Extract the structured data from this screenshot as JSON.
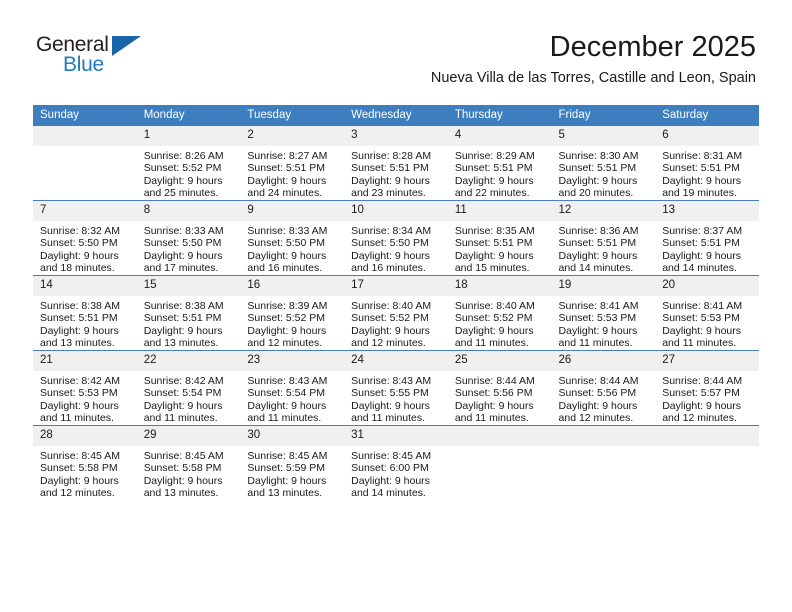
{
  "brand": {
    "name_top": "General",
    "name_bottom": "Blue",
    "triangle_color": "#1764a8",
    "blue_color": "#1d7cc4"
  },
  "header": {
    "title": "December 2025",
    "location": "Nueva Villa de las Torres, Castille and Leon, Spain",
    "header_bg": "#3d7ebf"
  },
  "calendar": {
    "weekday_headers": [
      "Sunday",
      "Monday",
      "Tuesday",
      "Wednesday",
      "Thursday",
      "Friday",
      "Saturday"
    ],
    "weeks": [
      [
        {
          "day": "",
          "sunrise": "",
          "sunset": "",
          "daylight_line1": "",
          "daylight_line2": ""
        },
        {
          "day": "1",
          "sunrise": "Sunrise: 8:26 AM",
          "sunset": "Sunset: 5:52 PM",
          "daylight_line1": "Daylight: 9 hours",
          "daylight_line2": "and 25 minutes."
        },
        {
          "day": "2",
          "sunrise": "Sunrise: 8:27 AM",
          "sunset": "Sunset: 5:51 PM",
          "daylight_line1": "Daylight: 9 hours",
          "daylight_line2": "and 24 minutes."
        },
        {
          "day": "3",
          "sunrise": "Sunrise: 8:28 AM",
          "sunset": "Sunset: 5:51 PM",
          "daylight_line1": "Daylight: 9 hours",
          "daylight_line2": "and 23 minutes."
        },
        {
          "day": "4",
          "sunrise": "Sunrise: 8:29 AM",
          "sunset": "Sunset: 5:51 PM",
          "daylight_line1": "Daylight: 9 hours",
          "daylight_line2": "and 22 minutes."
        },
        {
          "day": "5",
          "sunrise": "Sunrise: 8:30 AM",
          "sunset": "Sunset: 5:51 PM",
          "daylight_line1": "Daylight: 9 hours",
          "daylight_line2": "and 20 minutes."
        },
        {
          "day": "6",
          "sunrise": "Sunrise: 8:31 AM",
          "sunset": "Sunset: 5:51 PM",
          "daylight_line1": "Daylight: 9 hours",
          "daylight_line2": "and 19 minutes."
        }
      ],
      [
        {
          "day": "7",
          "sunrise": "Sunrise: 8:32 AM",
          "sunset": "Sunset: 5:50 PM",
          "daylight_line1": "Daylight: 9 hours",
          "daylight_line2": "and 18 minutes."
        },
        {
          "day": "8",
          "sunrise": "Sunrise: 8:33 AM",
          "sunset": "Sunset: 5:50 PM",
          "daylight_line1": "Daylight: 9 hours",
          "daylight_line2": "and 17 minutes."
        },
        {
          "day": "9",
          "sunrise": "Sunrise: 8:33 AM",
          "sunset": "Sunset: 5:50 PM",
          "daylight_line1": "Daylight: 9 hours",
          "daylight_line2": "and 16 minutes."
        },
        {
          "day": "10",
          "sunrise": "Sunrise: 8:34 AM",
          "sunset": "Sunset: 5:50 PM",
          "daylight_line1": "Daylight: 9 hours",
          "daylight_line2": "and 16 minutes."
        },
        {
          "day": "11",
          "sunrise": "Sunrise: 8:35 AM",
          "sunset": "Sunset: 5:51 PM",
          "daylight_line1": "Daylight: 9 hours",
          "daylight_line2": "and 15 minutes."
        },
        {
          "day": "12",
          "sunrise": "Sunrise: 8:36 AM",
          "sunset": "Sunset: 5:51 PM",
          "daylight_line1": "Daylight: 9 hours",
          "daylight_line2": "and 14 minutes."
        },
        {
          "day": "13",
          "sunrise": "Sunrise: 8:37 AM",
          "sunset": "Sunset: 5:51 PM",
          "daylight_line1": "Daylight: 9 hours",
          "daylight_line2": "and 14 minutes."
        }
      ],
      [
        {
          "day": "14",
          "sunrise": "Sunrise: 8:38 AM",
          "sunset": "Sunset: 5:51 PM",
          "daylight_line1": "Daylight: 9 hours",
          "daylight_line2": "and 13 minutes."
        },
        {
          "day": "15",
          "sunrise": "Sunrise: 8:38 AM",
          "sunset": "Sunset: 5:51 PM",
          "daylight_line1": "Daylight: 9 hours",
          "daylight_line2": "and 13 minutes."
        },
        {
          "day": "16",
          "sunrise": "Sunrise: 8:39 AM",
          "sunset": "Sunset: 5:52 PM",
          "daylight_line1": "Daylight: 9 hours",
          "daylight_line2": "and 12 minutes."
        },
        {
          "day": "17",
          "sunrise": "Sunrise: 8:40 AM",
          "sunset": "Sunset: 5:52 PM",
          "daylight_line1": "Daylight: 9 hours",
          "daylight_line2": "and 12 minutes."
        },
        {
          "day": "18",
          "sunrise": "Sunrise: 8:40 AM",
          "sunset": "Sunset: 5:52 PM",
          "daylight_line1": "Daylight: 9 hours",
          "daylight_line2": "and 11 minutes."
        },
        {
          "day": "19",
          "sunrise": "Sunrise: 8:41 AM",
          "sunset": "Sunset: 5:53 PM",
          "daylight_line1": "Daylight: 9 hours",
          "daylight_line2": "and 11 minutes."
        },
        {
          "day": "20",
          "sunrise": "Sunrise: 8:41 AM",
          "sunset": "Sunset: 5:53 PM",
          "daylight_line1": "Daylight: 9 hours",
          "daylight_line2": "and 11 minutes."
        }
      ],
      [
        {
          "day": "21",
          "sunrise": "Sunrise: 8:42 AM",
          "sunset": "Sunset: 5:53 PM",
          "daylight_line1": "Daylight: 9 hours",
          "daylight_line2": "and 11 minutes."
        },
        {
          "day": "22",
          "sunrise": "Sunrise: 8:42 AM",
          "sunset": "Sunset: 5:54 PM",
          "daylight_line1": "Daylight: 9 hours",
          "daylight_line2": "and 11 minutes."
        },
        {
          "day": "23",
          "sunrise": "Sunrise: 8:43 AM",
          "sunset": "Sunset: 5:54 PM",
          "daylight_line1": "Daylight: 9 hours",
          "daylight_line2": "and 11 minutes."
        },
        {
          "day": "24",
          "sunrise": "Sunrise: 8:43 AM",
          "sunset": "Sunset: 5:55 PM",
          "daylight_line1": "Daylight: 9 hours",
          "daylight_line2": "and 11 minutes."
        },
        {
          "day": "25",
          "sunrise": "Sunrise: 8:44 AM",
          "sunset": "Sunset: 5:56 PM",
          "daylight_line1": "Daylight: 9 hours",
          "daylight_line2": "and 11 minutes."
        },
        {
          "day": "26",
          "sunrise": "Sunrise: 8:44 AM",
          "sunset": "Sunset: 5:56 PM",
          "daylight_line1": "Daylight: 9 hours",
          "daylight_line2": "and 12 minutes."
        },
        {
          "day": "27",
          "sunrise": "Sunrise: 8:44 AM",
          "sunset": "Sunset: 5:57 PM",
          "daylight_line1": "Daylight: 9 hours",
          "daylight_line2": "and 12 minutes."
        }
      ],
      [
        {
          "day": "28",
          "sunrise": "Sunrise: 8:45 AM",
          "sunset": "Sunset: 5:58 PM",
          "daylight_line1": "Daylight: 9 hours",
          "daylight_line2": "and 12 minutes."
        },
        {
          "day": "29",
          "sunrise": "Sunrise: 8:45 AM",
          "sunset": "Sunset: 5:58 PM",
          "daylight_line1": "Daylight: 9 hours",
          "daylight_line2": "and 13 minutes."
        },
        {
          "day": "30",
          "sunrise": "Sunrise: 8:45 AM",
          "sunset": "Sunset: 5:59 PM",
          "daylight_line1": "Daylight: 9 hours",
          "daylight_line2": "and 13 minutes."
        },
        {
          "day": "31",
          "sunrise": "Sunrise: 8:45 AM",
          "sunset": "Sunset: 6:00 PM",
          "daylight_line1": "Daylight: 9 hours",
          "daylight_line2": "and 14 minutes."
        },
        {
          "day": "",
          "sunrise": "",
          "sunset": "",
          "daylight_line1": "",
          "daylight_line2": ""
        },
        {
          "day": "",
          "sunrise": "",
          "sunset": "",
          "daylight_line1": "",
          "daylight_line2": ""
        },
        {
          "day": "",
          "sunrise": "",
          "sunset": "",
          "daylight_line1": "",
          "daylight_line2": ""
        }
      ]
    ]
  }
}
